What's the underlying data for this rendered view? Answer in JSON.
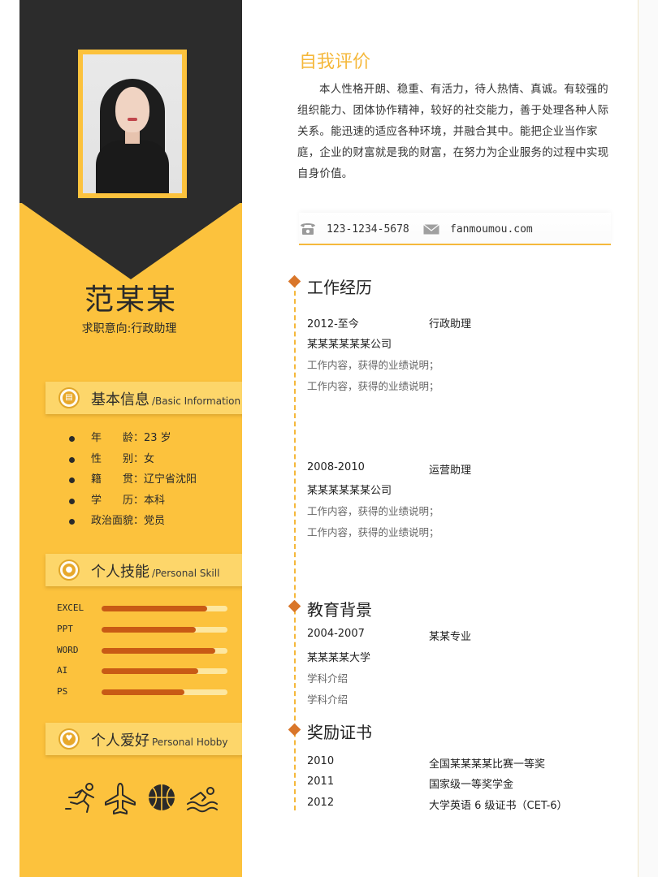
{
  "profile": {
    "name": "范某某",
    "intent": "求职意向:行政助理"
  },
  "basic_info": {
    "title": "基本信息",
    "title_en": "/Basic Information",
    "items": [
      "年　　龄：23 岁",
      "性　　别：女",
      "籍　　贯：辽宁省沈阳",
      "学　　历：本科",
      "政治面貌：党员"
    ]
  },
  "skills": {
    "title": "个人技能",
    "title_en": "/Personal Skill",
    "items": [
      {
        "label": "EXCEL",
        "level": 0.84
      },
      {
        "label": "PPT",
        "level": 0.75
      },
      {
        "label": "WORD",
        "level": 0.9
      },
      {
        "label": "AI",
        "level": 0.77
      },
      {
        "label": "PS",
        "level": 0.66
      }
    ]
  },
  "hobby": {
    "title": "个人爱好",
    "title_en": "Personal Hobby",
    "icons": [
      "running-icon",
      "airplane-icon",
      "basketball-icon",
      "swimming-icon"
    ]
  },
  "self_eval": {
    "title": "自我评价",
    "text": "本人性格开朗、稳重、有活力，待人热情、真诚。有较强的组织能力、团体协作精神，较好的社交能力，善于处理各种人际关系。能迅速的适应各种环境，并融合其中。能把企业当作家庭，企业的财富就是我的财富，在努力为企业服务的过程中实现自身价值。"
  },
  "contact": {
    "phone": "123-1234-5678",
    "email": "fanmoumou.com"
  },
  "work": {
    "title": "工作经历",
    "entries": [
      {
        "period": "2012-至今",
        "role": "行政助理",
        "company": "某某某某某某公司",
        "details": [
          "工作内容，获得的业绩说明；",
          "工作内容，获得的业绩说明；"
        ]
      },
      {
        "period": "2008-2010",
        "role": "运营助理",
        "company": "某某某某某某公司",
        "details": [
          "工作内容，获得的业绩说明；",
          "工作内容，获得的业绩说明；"
        ]
      }
    ]
  },
  "education": {
    "title": "教育背景",
    "period": "2004-2007",
    "major": "某某专业",
    "school": "某某某某大学",
    "details": [
      "学科介绍",
      "学科介绍"
    ]
  },
  "awards": {
    "title": "奖励证书",
    "items": [
      {
        "year": "2010",
        "name": "全国某某某某比赛一等奖"
      },
      {
        "year": "2011",
        "name": "国家级一等奖学金"
      },
      {
        "year": "2012",
        "name": "大学英语 6 级证书（CET-6）"
      }
    ]
  },
  "colors": {
    "accent": "#fcc23d",
    "dark": "#2c2c2c",
    "bar": "#c85a15",
    "diamond": "#d9762a"
  }
}
